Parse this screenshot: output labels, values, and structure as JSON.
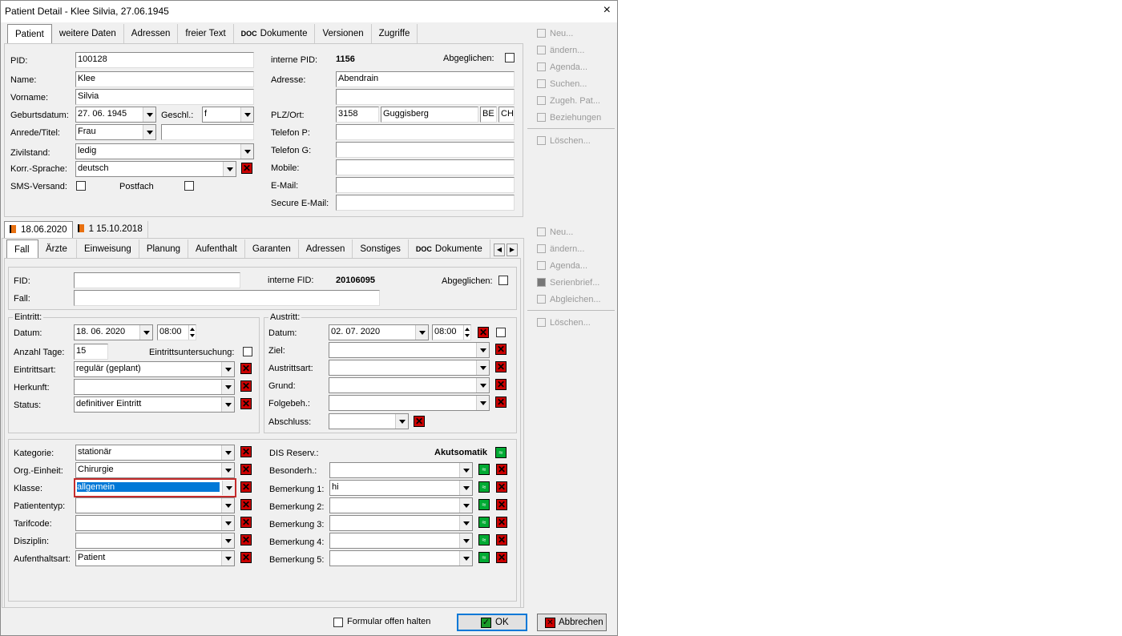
{
  "window": {
    "title": "Patient Detail - Klee Silvia, 27.06.1945",
    "close": "×"
  },
  "ptabs": [
    "Patient",
    "weitere Daten",
    "Adressen",
    "freier Text",
    "Dokumente",
    "Versionen",
    "Zugriffe"
  ],
  "doc_badge": "DOC",
  "patient": {
    "pid_label": "PID:",
    "pid": "100128",
    "name_label": "Name:",
    "name": "Klee",
    "vorname_label": "Vorname:",
    "vorname": "Silvia",
    "geb_label": "Geburtsdatum:",
    "geb": "27. 06. 1945",
    "geschl_label": "Geschl.:",
    "geschl": "f",
    "anrede_label": "Anrede/Titel:",
    "anrede": "Frau",
    "zivil_label": "Zivilstand:",
    "zivil": "ledig",
    "korr_label": "Korr.-Sprache:",
    "korr": "deutsch",
    "sms_label": "SMS-Versand:",
    "postfach_label": "Postfach",
    "ipid_label": "interne PID:",
    "ipid": "1156",
    "abgl_label": "Abgeglichen:",
    "adresse_label": "Adresse:",
    "adresse": "Abendrain",
    "plz_label": "PLZ/Ort:",
    "plz": "3158",
    "ort": "Guggisberg",
    "kanton": "BE",
    "land": "CH",
    "telp_label": "Telefon P:",
    "telg_label": "Telefon G:",
    "mobile_label": "Mobile:",
    "email_label": "E-Mail:",
    "semail_label": "Secure E-Mail:"
  },
  "side1": [
    "Neu...",
    "ändern...",
    "Agenda...",
    "Suchen...",
    "Zugeh. Pat...",
    "Beziehungen",
    "Löschen..."
  ],
  "side2": [
    "Neu...",
    "ändern...",
    "Agenda...",
    "Serienbrief...",
    "Abgleichen...",
    "Löschen..."
  ],
  "ctabs": [
    "18.06.2020",
    "1 15.10.2018"
  ],
  "ftabs": [
    "Fall",
    "Ärzte",
    "Einweisung",
    "Planung",
    "Aufenthalt",
    "Garanten",
    "Adressen",
    "Sonstiges",
    "Dokumente"
  ],
  "fall": {
    "fid_label": "FID:",
    "ifid_label": "interne FID:",
    "ifid": "20106095",
    "abgl_label": "Abgeglichen:",
    "fall_label": "Fall:",
    "eintritt_title": "Eintritt:",
    "datum_label": "Datum:",
    "e_datum": "18. 06. 2020",
    "e_zeit": "08:00",
    "tage_label": "Anzahl Tage:",
    "tage": "15",
    "untersuchung_label": "Eintrittsuntersuchung:",
    "eart_label": "Eintrittsart:",
    "eart": "regulär (geplant)",
    "herkunft_label": "Herkunft:",
    "status_label": "Status:",
    "status": "definitiver Eintritt",
    "austritt_title": "Austritt:",
    "a_datum": "02. 07. 2020",
    "a_zeit": "08:00",
    "ziel_label": "Ziel:",
    "aart_label": "Austrittsart:",
    "grund_label": "Grund:",
    "folge_label": "Folgebeh.:",
    "abschluss_label": "Abschluss:",
    "kat_label": "Kategorie:",
    "kat": "stationär",
    "org_label": "Org.-Einheit:",
    "org": "Chirurgie",
    "klasse_label": "Klasse:",
    "klasse": "allgemein",
    "ptyp_label": "Patiententyp:",
    "tarif_label": "Tarifcode:",
    "diszi_label": "Disziplin:",
    "aufart_label": "Aufenthaltsart:",
    "aufart": "Patient",
    "dis_label": "DIS Reserv.:",
    "dis": "Akutsomatik",
    "besond_label": "Besonderh.:",
    "bem1_label": "Bemerkung 1:",
    "bem1": "hi",
    "bem2_label": "Bemerkung 2:",
    "bem3_label": "Bemerkung 3:",
    "bem4_label": "Bemerkung 4:",
    "bem5_label": "Bemerkung 5:"
  },
  "footer": {
    "keep_open": "Formular offen halten",
    "ok": "OK",
    "cancel": "Abbrechen"
  }
}
